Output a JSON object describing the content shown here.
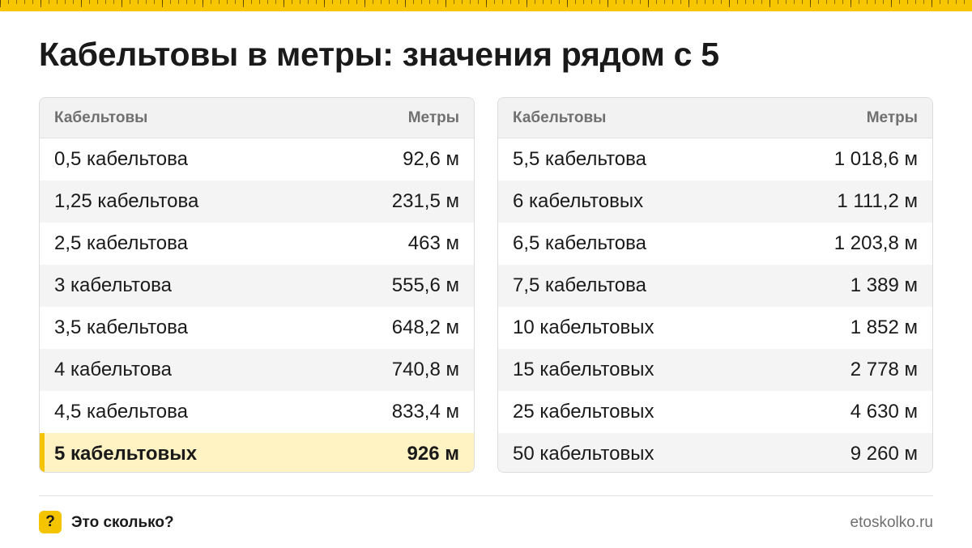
{
  "title": "Кабельтовы в метры: значения рядом с 5",
  "colors": {
    "accent": "#f5c400",
    "highlight_row": "#fff3c4"
  },
  "tables": [
    {
      "headers": {
        "left": "Кабельтовы",
        "right": "Метры"
      },
      "rows": [
        {
          "label": "0,5 кабельтова",
          "value": "92,6 м"
        },
        {
          "label": "1,25 кабельтова",
          "value": "231,5 м"
        },
        {
          "label": "2,5 кабельтова",
          "value": "463 м"
        },
        {
          "label": "3 кабельтова",
          "value": "555,6 м"
        },
        {
          "label": "3,5 кабельтова",
          "value": "648,2 м"
        },
        {
          "label": "4 кабельтова",
          "value": "740,8 м"
        },
        {
          "label": "4,5 кабельтова",
          "value": "833,4 м"
        },
        {
          "label": "5 кабельтовых",
          "value": "926 м",
          "highlighted": true
        }
      ]
    },
    {
      "headers": {
        "left": "Кабельтовы",
        "right": "Метры"
      },
      "rows": [
        {
          "label": "5,5 кабельтова",
          "value": "1 018,6 м"
        },
        {
          "label": "6 кабельтовых",
          "value": "1 111,2 м"
        },
        {
          "label": "6,5 кабельтова",
          "value": "1 203,8 м"
        },
        {
          "label": "7,5 кабельтова",
          "value": "1 389 м"
        },
        {
          "label": "10 кабельтовых",
          "value": "1 852 м"
        },
        {
          "label": "15 кабельтовых",
          "value": "2 778 м"
        },
        {
          "label": "25 кабельтовых",
          "value": "4 630 м"
        },
        {
          "label": "50 кабельтовых",
          "value": "9 260 м"
        }
      ]
    }
  ],
  "footer": {
    "badge_icon": "question-mark-icon",
    "badge_text": "?",
    "brand": "Это сколько?",
    "site": "etoskolko.ru"
  }
}
